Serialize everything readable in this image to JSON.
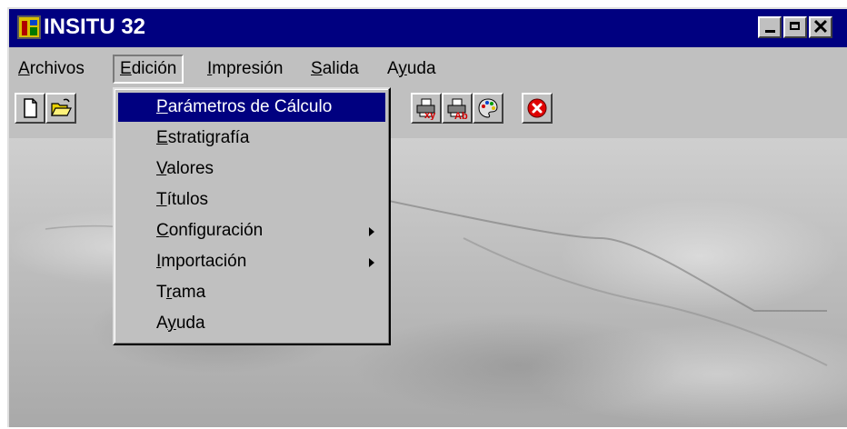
{
  "window": {
    "title": "INSITU 32",
    "buttons": {
      "minimize": "minimize-icon",
      "maximize": "maximize-icon",
      "close": "✕"
    }
  },
  "menubar": {
    "items": [
      {
        "label": "Archivos",
        "mnemonic_index": 0
      },
      {
        "label": "Edición",
        "mnemonic_index": 0
      },
      {
        "label": "Impresión",
        "mnemonic_index": 0
      },
      {
        "label": "Salida",
        "mnemonic_index": 0
      },
      {
        "label": "Ayuda",
        "mnemonic_index": 1
      }
    ],
    "active": "Edición"
  },
  "toolbar": {
    "tools": [
      "new-document-icon",
      "open-folder-icon",
      "print-xy-icon",
      "print-ab-icon",
      "palette-icon",
      "exit-icon"
    ]
  },
  "dropdown": {
    "items": [
      {
        "label": "Parámetros de Cálculo",
        "selected": true,
        "submenu": false
      },
      {
        "label": "Estratigrafía",
        "selected": false,
        "submenu": false
      },
      {
        "label": "Valores",
        "selected": false,
        "submenu": false
      },
      {
        "label": "Títulos",
        "selected": false,
        "submenu": false
      },
      {
        "label": "Configuración",
        "selected": false,
        "submenu": true
      },
      {
        "label": "Importación",
        "selected": false,
        "submenu": true
      },
      {
        "label": "Trama",
        "selected": false,
        "submenu": false
      },
      {
        "label": "Ayuda",
        "selected": false,
        "submenu": false
      }
    ]
  },
  "colors": {
    "titlebar": "#000080",
    "face": "#c0c0c0",
    "highlight": "#000080"
  }
}
